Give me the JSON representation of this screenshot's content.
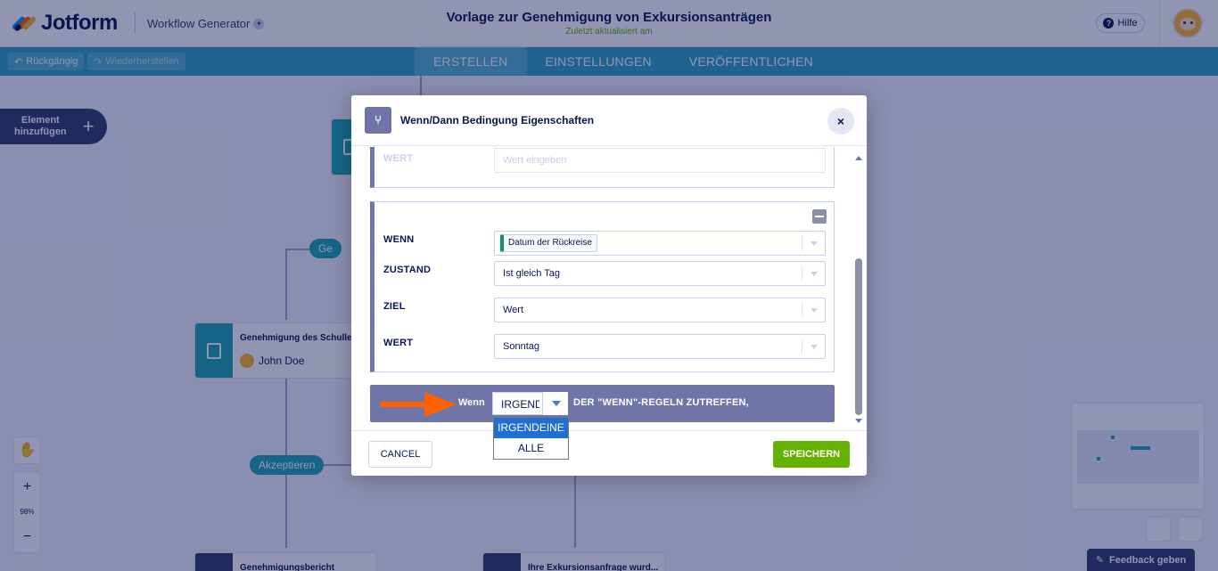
{
  "header": {
    "logo_text": "Jotform",
    "workflow_generator": "Workflow Generator",
    "title": "Vorlage zur Genehmigung von Exkursionsanträgen",
    "subtitle": "Zuletzt aktualisiert am",
    "help_label": "Hilfe"
  },
  "toolbar": {
    "undo_label": "Rückgängig",
    "redo_label": "Wiederherstellen",
    "tabs": [
      {
        "label": "ERSTELLEN",
        "active": true
      },
      {
        "label": "EINSTELLUNGEN",
        "active": false
      },
      {
        "label": "VERÖFFENTLICHEN",
        "active": false
      }
    ]
  },
  "canvas": {
    "add_element_label_1": "Element",
    "add_element_label_2": "hinzufügen",
    "pill_top": "Ge",
    "pill_accept": "Akzeptieren",
    "node_approval_title": "Genehmigung des Schulle",
    "node_approval_user": "John Doe",
    "node_report_title": "Genehmigungsbericht",
    "node_request_title": "Ihre Exkursionsanfrage wurd...",
    "zoom_percent": "98%",
    "feedback_label": "Feedback geben"
  },
  "modal": {
    "title": "Wenn/Dann Bedingung Eigenschaften",
    "close_symbol": "×",
    "condition_1": {
      "wert_label": "WERT",
      "wert_placeholder": "Wert eingeben"
    },
    "condition_2": {
      "wenn_label": "WENN",
      "wenn_chip": "Datum der Rückreise",
      "zustand_label": "ZUSTAND",
      "zustand_value": "Ist gleich Tag",
      "ziel_label": "ZIEL",
      "ziel_value": "Wert",
      "wert_label": "WERT",
      "wert_value": "Sonntag"
    },
    "rule_bar": {
      "wenn_label": "Wenn",
      "select_value": "IRGENDEINE",
      "rule_text": "DER \"WENN\"-REGELN ZUTREFFEN,"
    },
    "dropdown_options": [
      "IRGENDEINE",
      "ALLE"
    ],
    "cancel_label": "CANCEL",
    "save_label": "SPEICHERN"
  },
  "colors": {
    "accent_teal": "#20a8b2",
    "toolbar": "#34a5c4",
    "navy": "#0a1551",
    "save_green": "#64b200",
    "purple": "#6f76a7",
    "annotation_arrow": "#ff6100"
  }
}
